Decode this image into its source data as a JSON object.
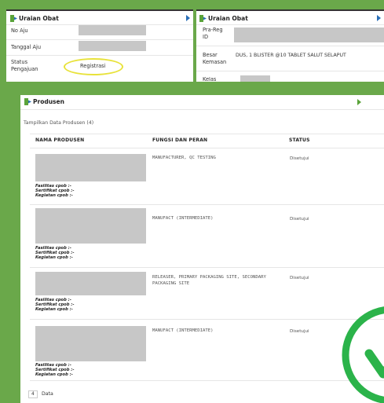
{
  "top_left": {
    "title": "Uraian Obat",
    "rows": [
      {
        "label": "No Aju"
      },
      {
        "label": "Tanggal Aju"
      },
      {
        "label": "Status Pengajuan",
        "value": "Registrasi"
      }
    ]
  },
  "top_right": {
    "title": "Uraian Obat",
    "rows": [
      {
        "label": "Pra-Reg ID"
      },
      {
        "label": "Besar Kemasan",
        "value": "DUS, 1 BLISTER @10 TABLET SALUT SELAPUT"
      },
      {
        "label": "Kelas"
      }
    ]
  },
  "produsen": {
    "title": "Produsen",
    "subtitle": "Tampilkan Data Produsen (4)",
    "columns": [
      "NAMA PRODUSEN",
      "FUNGSI DAN PERAN",
      "STATUS"
    ],
    "rows": [
      {
        "fungsi": "MANUFACTURER, QC TESTING",
        "status": "Disetujui",
        "cpob": [
          "Fasilitas cpob :-",
          "Sertifikat cpob :-",
          "Kegiatan cpob :-"
        ]
      },
      {
        "fungsi": "MANUFACT (INTERMEDIATE)",
        "status": "Disetujui",
        "cpob": [
          "Fasilitas cpob :-",
          "Sertifikat cpob :-",
          "Kegiatan cpob :-"
        ]
      },
      {
        "fungsi": "RELEASER, PRIMARY PACKAGING SITE, SECONDARY PACKAGING SITE",
        "status": "Disetujui",
        "cpob": [
          "Fasilitas cpob :-",
          "Sertifikat cpob :-",
          "Kegiatan cpob :-"
        ]
      },
      {
        "fungsi": "MANUFACT (INTERMEDIATE)",
        "status": "Disetujui",
        "cpob": [
          "Fasilitas cpob :-",
          "Sertifikat cpob :-",
          "Kegiatan cpob :-"
        ]
      }
    ],
    "footer_count": "4",
    "footer_label": "Data"
  },
  "colors": {
    "background": "#6aa84a",
    "highlight_ellipse": "#e8e23a",
    "checkmark": "#2bb34a",
    "nav_arrow": "#2a6fb8"
  }
}
